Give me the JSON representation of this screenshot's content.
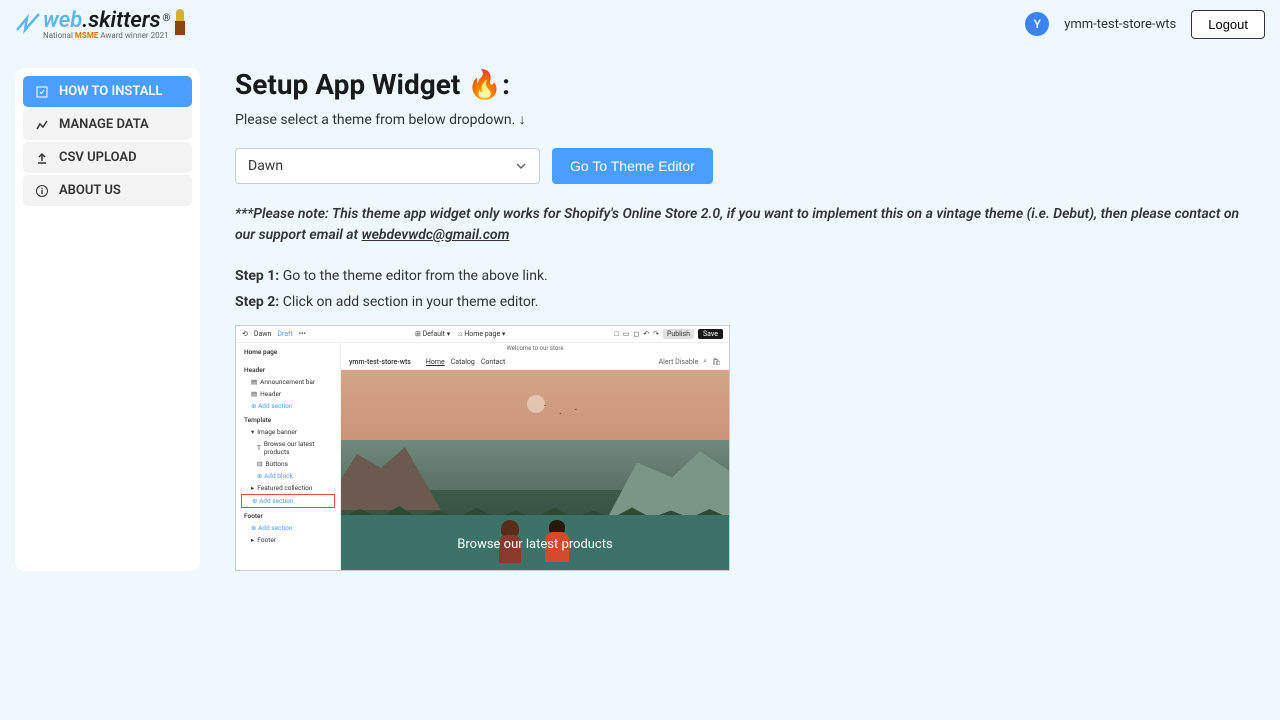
{
  "header": {
    "logo_prefix": "web",
    "logo_suffix": ".skitters",
    "logo_subtitle_pre": "National ",
    "logo_subtitle_msme": "MSME",
    "logo_subtitle_post": " Award winner 2021",
    "avatar_letter": "Y",
    "store_name": "ymm-test-store-wts",
    "logout": "Logout"
  },
  "sidebar": {
    "items": [
      {
        "label": "HOW TO INSTALL",
        "active": true
      },
      {
        "label": "MANAGE DATA",
        "active": false
      },
      {
        "label": "CSV UPLOAD",
        "active": false
      },
      {
        "label": "ABOUT US",
        "active": false
      }
    ]
  },
  "main": {
    "title": "Setup App Widget 🔥:",
    "subtitle": "Please select a theme from below dropdown. ↓",
    "dropdown_value": "Dawn",
    "goto_button": "Go To Theme Editor",
    "note_prefix": "***Please note: This theme app widget only works for Shopify's Online Store 2.0, if you want to implement this on a vintage theme (i.e. Debut), then please contact on our support email at ",
    "note_email": "webdevwdc@gmail.com",
    "step1_label": "Step 1:",
    "step1_text": " Go to the theme editor from the above link.",
    "step2_label": "Step 2:",
    "step2_text": " Click on add section in your theme editor."
  },
  "screenshot": {
    "top_left": {
      "dawn": "Dawn",
      "draft": "Draft",
      "menu": "•••"
    },
    "top_center": {
      "default": "Default",
      "homepage": "Home page"
    },
    "top_right": {
      "publish": "Publish",
      "save": "Save"
    },
    "side": {
      "title": "Home page",
      "header_section": "Header",
      "header_item": "Announcement bar",
      "header_label": "Header",
      "add_section1": "Add section",
      "template": "Template",
      "image_banner": "Image banner",
      "browse": "Browse our latest products",
      "buttons": "Buttons",
      "add_block": "Add block",
      "featured": "Featured collection",
      "add_section2": "Add section",
      "footer": "Footer",
      "add_section3": "Add section",
      "footer_item": "Footer"
    },
    "preview": {
      "banner": "Welcome to our store",
      "store_name": "ymm-test-store-wts",
      "nav_home": "Home",
      "nav_catalog": "Catalog",
      "nav_contact": "Contact",
      "alert": "Alert Disable",
      "hero_text": "Browse our latest products"
    }
  }
}
